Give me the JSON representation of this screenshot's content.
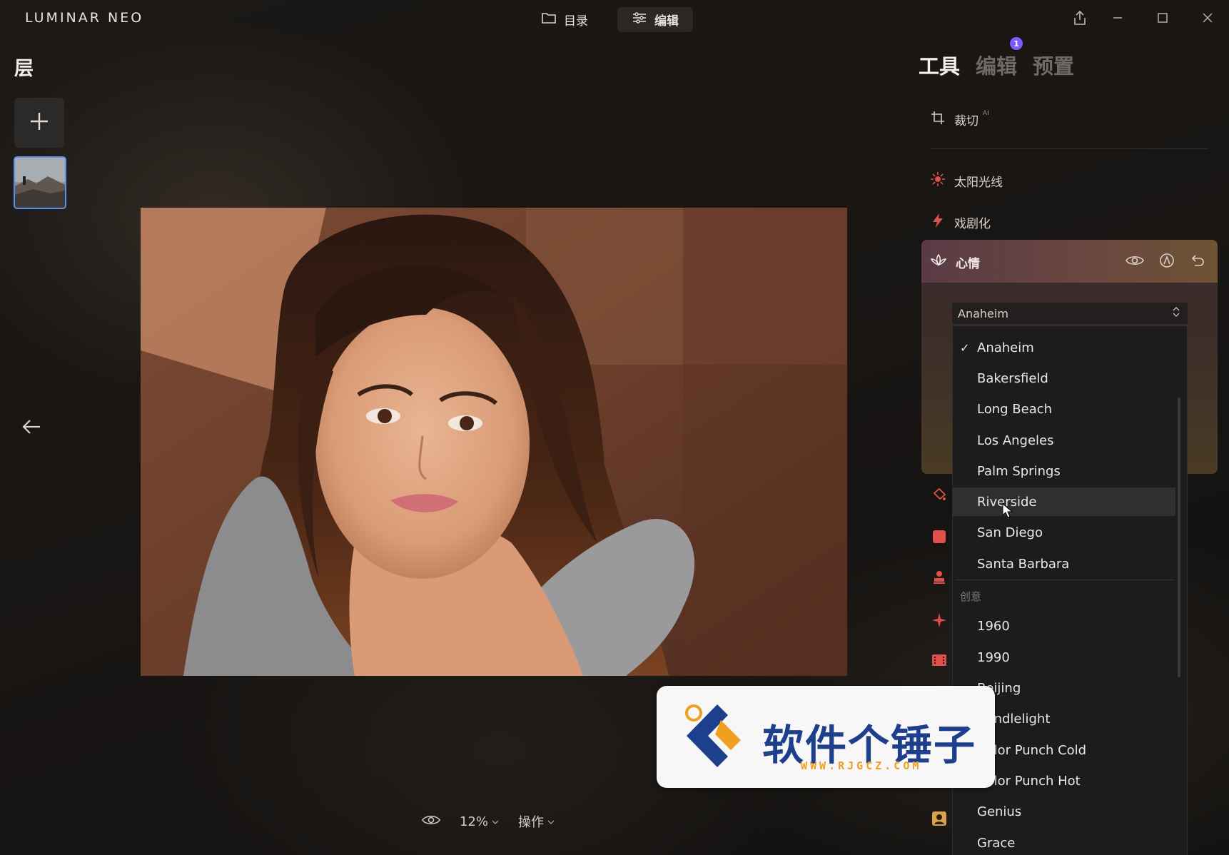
{
  "app": {
    "logo": "LUMINAR NEO"
  },
  "header": {
    "catalog_label": "目录",
    "edit_label": "编辑"
  },
  "left_panel": {
    "title": "层"
  },
  "bottom_bar": {
    "zoom": "12%",
    "actions_label": "操作"
  },
  "right_panel": {
    "tabs": [
      {
        "label": "工具",
        "active": true
      },
      {
        "label": "编辑",
        "badge": "1"
      },
      {
        "label": "预置"
      }
    ],
    "tools": {
      "crop": {
        "label": "裁切",
        "ai_tag": "AI"
      },
      "sunrays": {
        "label": "太阳光线"
      },
      "dramatic": {
        "label": "戏剧化"
      },
      "mood": {
        "label": "心情"
      }
    },
    "mood_select": {
      "value": "Anaheim"
    }
  },
  "dropdown": {
    "check_mark": "✓",
    "items": [
      "Anaheim",
      "Bakersfield",
      "Long Beach",
      "Los Angeles",
      "Palm Springs",
      "Riverside",
      "San Diego",
      "Santa Barbara"
    ],
    "selected_index": 0,
    "hover_index": 5,
    "group_label": "创意",
    "creative_items": [
      "1960",
      "1990",
      "Beijing",
      "Candlelight",
      "Color Punch Cold",
      "Color Punch Hot",
      "Genius",
      "Grace"
    ]
  },
  "watermark": {
    "title": "软件个锤子",
    "url": "WWW.RJGCZ.COM"
  },
  "colors": {
    "accent": "#5b8ff0",
    "badge": "#7d5cff",
    "mood_header": "#6a4740",
    "dropdown_bg": "#1c1c1c"
  }
}
